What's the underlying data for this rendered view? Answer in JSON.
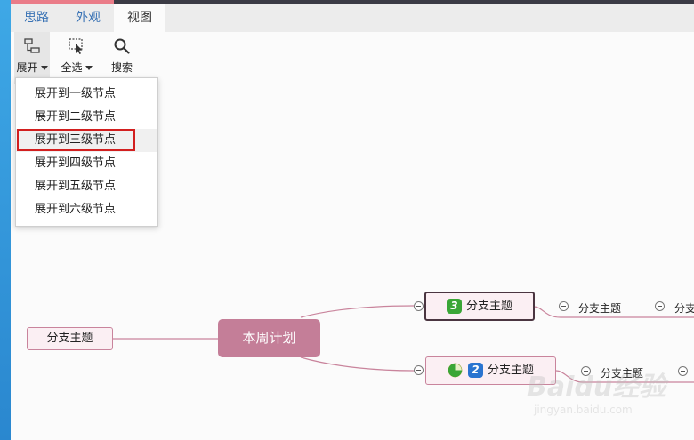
{
  "tabs": [
    {
      "label": "思路"
    },
    {
      "label": "外观"
    },
    {
      "label": "视图"
    }
  ],
  "toolbar": {
    "expand_label": "展开",
    "select_all_label": "全选",
    "search_label": "搜索"
  },
  "expand_menu": {
    "items": [
      {
        "label": "展开到一级节点"
      },
      {
        "label": "展开到二级节点"
      },
      {
        "label": "展开到三级节点"
      },
      {
        "label": "展开到四级节点"
      },
      {
        "label": "展开到五级节点"
      },
      {
        "label": "展开到六级节点"
      }
    ],
    "highlighted_index": 2
  },
  "mindmap": {
    "central": {
      "label": "本周计划"
    },
    "left_branch": {
      "label": "分支主题"
    },
    "branch_top": {
      "label": "分支主题",
      "priority": "3"
    },
    "branch_bottom": {
      "label": "分支主题",
      "priority": "2"
    },
    "sub_top_1": {
      "label": "分支主题"
    },
    "sub_top_2": {
      "label": "分支"
    },
    "sub_bottom_1": {
      "label": "分支主题"
    }
  },
  "watermark": {
    "brand": "Baidu经验",
    "url": "jingyan.baidu.com"
  },
  "colors": {
    "accent_blue": "#3a73b5",
    "main_node": "#c47e98",
    "branch_fill": "#fbeff3",
    "highlight_red": "#d21f1f"
  }
}
